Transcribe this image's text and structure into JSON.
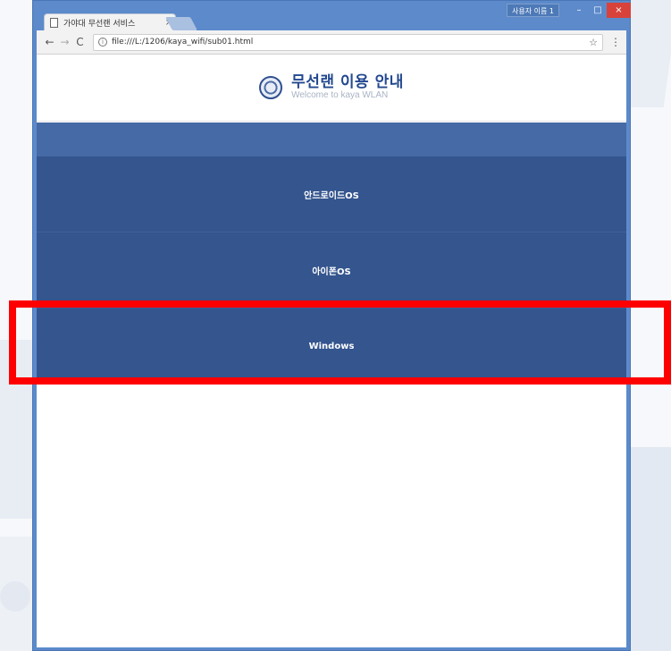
{
  "browser": {
    "tab_title": "가야대 무선랜 서비스",
    "tab_close": "×",
    "user_badge": "사용자 이름 1",
    "min_glyph": "–",
    "max_glyph": "□",
    "close_glyph": "×",
    "back_glyph": "←",
    "forward_glyph": "→",
    "reload_glyph": "C",
    "info_glyph": "i",
    "address": "file:///L:/1206/kaya_wifi/sub01.html",
    "star_glyph": "☆",
    "menu_glyph": "⋮"
  },
  "site": {
    "title": "무선랜 이용 안내",
    "subtitle": "Welcome to kaya WLAN",
    "menu": [
      {
        "label": "안드로이드OS"
      },
      {
        "label": "아이폰OS"
      },
      {
        "label": "Windows"
      }
    ]
  },
  "colors": {
    "header_band": "#456aa5",
    "menu_bg": "#34558e",
    "highlight": "#ff0000",
    "brand": "#23498f"
  },
  "icons": [
    "page-icon",
    "back-icon",
    "forward-icon",
    "reload-icon",
    "info-icon",
    "star-icon",
    "menu-icon",
    "logo-emblem"
  ]
}
